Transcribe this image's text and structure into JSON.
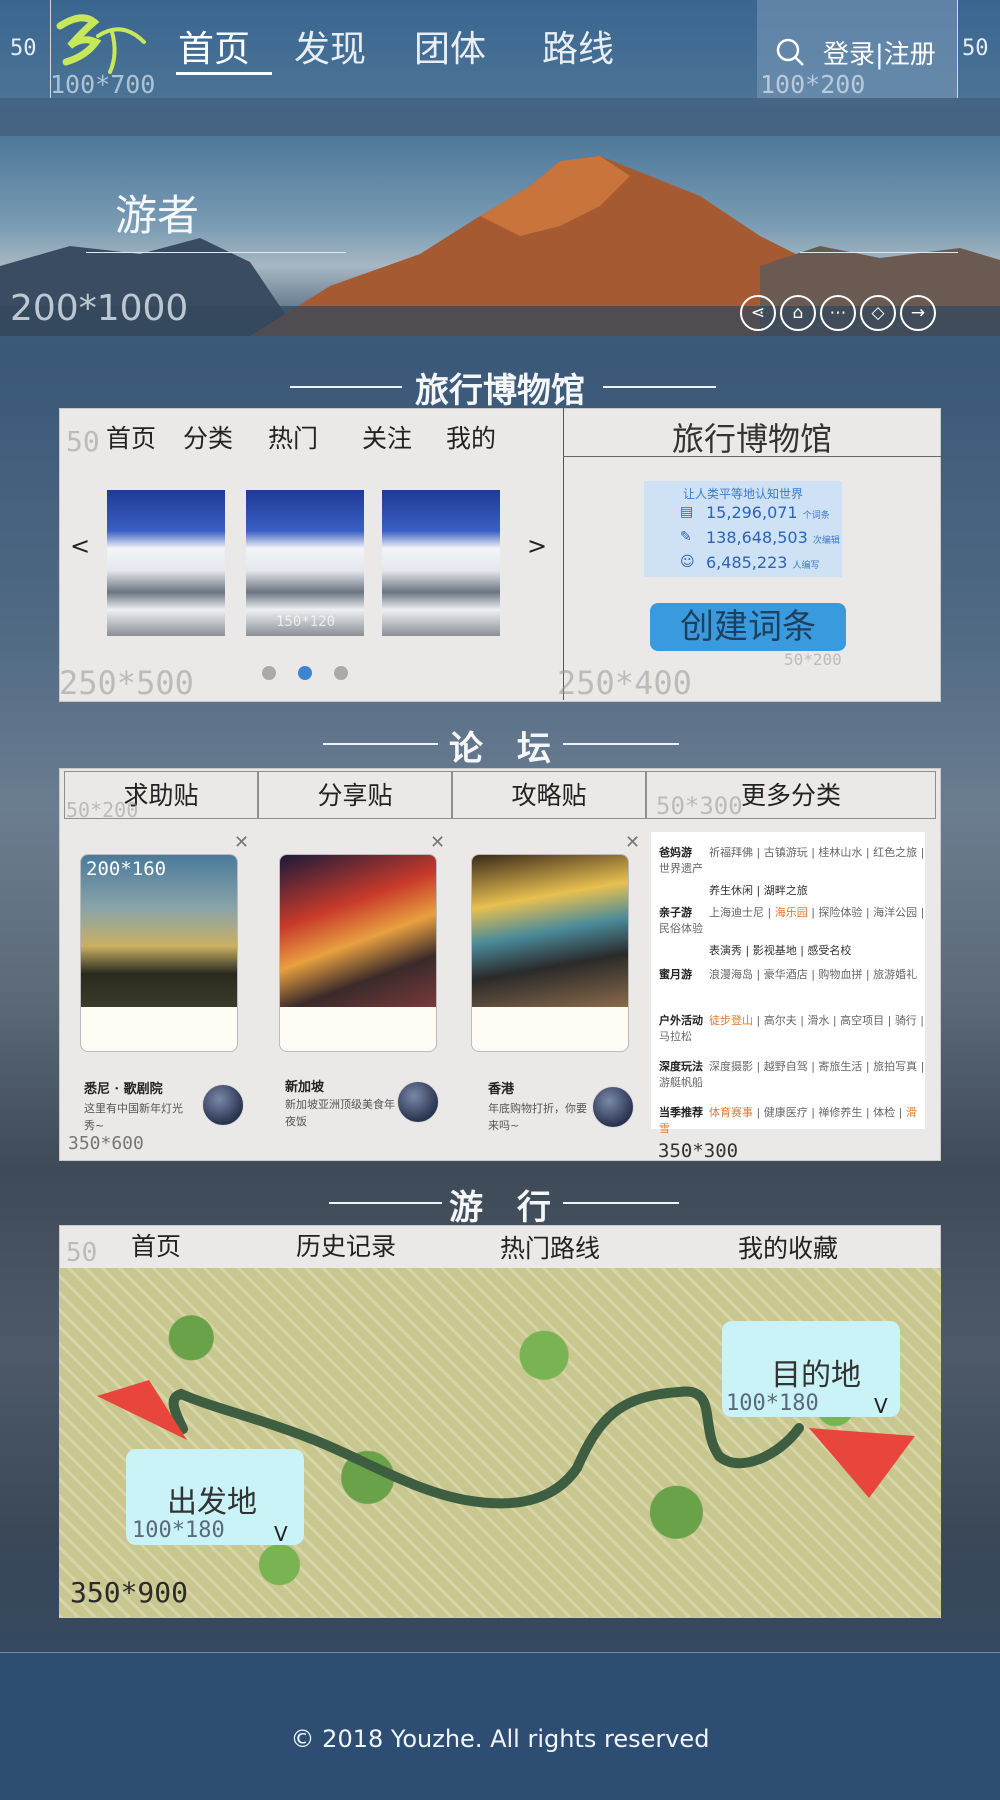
{
  "header": {
    "left_width_label": "50",
    "right_width_label": "50",
    "logo_dim": "100*700",
    "nav": [
      "首页",
      "发现",
      "团体",
      "路线"
    ],
    "login": "登录|注册",
    "login_dim": "100*200"
  },
  "hero": {
    "title": "游者",
    "dim": "200*1000",
    "icons": [
      "share-icon",
      "home-icon",
      "more-icon",
      "tag-icon",
      "arrow-right-icon"
    ]
  },
  "museum": {
    "section_title": "旅行博物馆",
    "nav": [
      "首页",
      "分类",
      "热门",
      "关注",
      "我的"
    ],
    "nav_dim": "50",
    "thumb_dim": "150*120",
    "prev": "<",
    "next": ">",
    "left_dim": "250*500",
    "right_title": "旅行博物馆",
    "stats_header": "让人类平等地认知世界",
    "stats": [
      {
        "value": "15,296,071",
        "unit": "个词条"
      },
      {
        "value": "138,648,503",
        "unit": "次编辑"
      },
      {
        "value": "6,485,223",
        "unit": "人编写"
      }
    ],
    "create_button": "创建词条",
    "create_dim": "50*200",
    "right_dim": "250*400",
    "carousel": {
      "count": 3,
      "active": 1
    }
  },
  "forum": {
    "section_title": "论　坛",
    "tabs": [
      "求助贴",
      "分享贴",
      "攻略贴",
      "更多分类"
    ],
    "tabs_dim": "50*200",
    "more_dim": "50*300",
    "card_dim": "200*160",
    "posts": [
      {
        "title": "悉尼 · 歌剧院",
        "desc": "这里有中国新年灯光秀~"
      },
      {
        "title": "新加坡",
        "desc": "新加坡亚洲顶级美食年夜饭"
      },
      {
        "title": "香港",
        "desc": "年底购物打折，你要来吗~"
      }
    ],
    "posts_dim": "350*600",
    "categories_dim": "350*300",
    "categories": [
      {
        "label": "爸妈游",
        "line1": [
          "祈福拜佛",
          "古镇游玩",
          "桂林山水",
          "红色之旅",
          "世界遗产"
        ],
        "line2": [
          "养生休闲",
          "湖畔之旅"
        ]
      },
      {
        "label": "亲子游",
        "line1": [
          "上海迪士尼",
          "海乐园",
          "探险体验",
          "海洋公园",
          "民俗体验"
        ],
        "line2": [
          "表演秀",
          "影视基地",
          "感受名校"
        ]
      },
      {
        "label": "蜜月游",
        "line1": [
          "浪漫海岛",
          "豪华酒店",
          "购物血拼",
          "旅游婚礼"
        ],
        "line2": []
      },
      {
        "label": "户外活动",
        "line1": [
          "徒步登山",
          "高尔夫",
          "滑水",
          "高空项目",
          "骑行",
          "马拉松"
        ],
        "line2": []
      },
      {
        "label": "深度玩法",
        "line1": [
          "深度摄影",
          "越野自驾",
          "寄旅生活",
          "旅拍写真",
          "游艇帆船"
        ],
        "line2": []
      },
      {
        "label": "当季推荐",
        "line1": [
          "体育赛事",
          "健康医疗",
          "禅修养生",
          "体检",
          "滑雪"
        ],
        "line2": []
      }
    ]
  },
  "travel": {
    "section_title": "游　行",
    "nav": [
      "首页",
      "历史记录",
      "热门路线",
      "我的收藏"
    ],
    "nav_dim": "50",
    "start": "出发地",
    "end": "目的地",
    "bubble_dim": "100*180",
    "dropdown": "V",
    "map_dim": "350*900"
  },
  "footer": {
    "copyright": "© 2018 Youzhe. All rights reserved"
  },
  "colors": {
    "header_bg": "#3a6690",
    "accent_blue": "#3a9ade",
    "panel_bg": "#ebe9e8",
    "bubble": "#c9f3f6",
    "arrow_red": "#e8463c",
    "route_green": "#3d5e40",
    "highlight_orange": "#e07a2f",
    "footer_bg": "#2d4e72"
  }
}
